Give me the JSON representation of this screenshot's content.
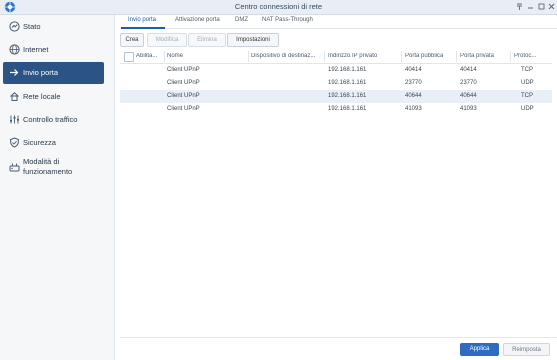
{
  "window": {
    "title": "Centro connessioni di rete",
    "controls": [
      "pin-icon",
      "minimize-icon",
      "maximize-icon",
      "close-icon"
    ]
  },
  "sidebar": {
    "items": [
      {
        "label": "Stato",
        "icon": "status-icon",
        "active": false
      },
      {
        "label": "Internet",
        "icon": "globe-icon",
        "active": false
      },
      {
        "label": "Invio porta",
        "icon": "port-forward-icon",
        "active": true
      },
      {
        "label": "Rete locale",
        "icon": "home-network-icon",
        "active": false
      },
      {
        "label": "Controllo traffico",
        "icon": "traffic-control-icon",
        "active": false
      },
      {
        "label": "Sicurezza",
        "icon": "shield-icon",
        "active": false
      },
      {
        "label": "Modalità di funzionamento",
        "icon": "operation-mode-icon",
        "active": false
      }
    ]
  },
  "tabs": [
    {
      "label": "Invio porta",
      "active": true
    },
    {
      "label": "Attivazione porta",
      "active": false
    },
    {
      "label": "DMZ",
      "active": false
    },
    {
      "label": "NAT Pass-Through",
      "active": false
    }
  ],
  "toolbar": {
    "create": "Crea",
    "edit": "Modifica",
    "delete": "Elimina",
    "settings": "Impostazioni"
  },
  "table": {
    "headers": {
      "enabled": "Abilita...",
      "name": "Nome",
      "device": "Dispositivo di destinaz...",
      "private_ip": "Indirizzo IP privato",
      "public_port": "Porta pubblica",
      "private_port": "Porta privata",
      "protocol": "Protoc..."
    },
    "rows": [
      {
        "name": "Client UPnP",
        "device": "",
        "private_ip": "192.168.1.161",
        "public_port": "40414",
        "private_port": "40414",
        "protocol": "TCP",
        "selected": false
      },
      {
        "name": "Client UPnP",
        "device": "",
        "private_ip": "192.168.1.161",
        "public_port": "23770",
        "private_port": "23770",
        "protocol": "UDP",
        "selected": false
      },
      {
        "name": "Client UPnP",
        "device": "",
        "private_ip": "192.168.1.161",
        "public_port": "40644",
        "private_port": "40644",
        "protocol": "TCP",
        "selected": true
      },
      {
        "name": "Client UPnP",
        "device": "",
        "private_ip": "192.168.1.161",
        "public_port": "41093",
        "private_port": "41093",
        "protocol": "UDP",
        "selected": false
      }
    ]
  },
  "footer": {
    "apply": "Applica",
    "reset": "Reimposta"
  },
  "colors": {
    "accent": "#2b5386",
    "primary_button": "#2d6cc0",
    "selected_row": "#e8eff7"
  }
}
